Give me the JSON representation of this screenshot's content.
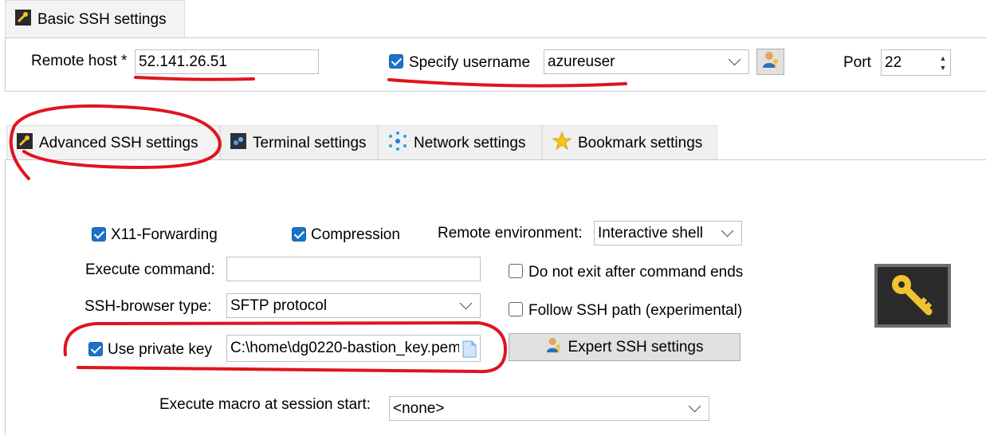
{
  "basic": {
    "tab_label": "Basic SSH settings",
    "remote_host_label": "Remote host *",
    "remote_host_value": "52.141.26.51",
    "specify_username_label": "Specify username",
    "specify_username_checked": true,
    "username_value": "azureuser",
    "port_label": "Port",
    "port_value": "22"
  },
  "tabs": [
    {
      "label": "Advanced SSH settings",
      "icon": "wrench-icon",
      "active": true
    },
    {
      "label": "Terminal settings",
      "icon": "terminal-icon",
      "active": false
    },
    {
      "label": "Network settings",
      "icon": "network-icon",
      "active": false
    },
    {
      "label": "Bookmark settings",
      "icon": "star-icon",
      "active": false
    }
  ],
  "advanced": {
    "x11_label": "X11-Forwarding",
    "x11_checked": true,
    "compression_label": "Compression",
    "compression_checked": true,
    "remote_env_label": "Remote environment:",
    "remote_env_value": "Interactive shell",
    "execute_command_label": "Execute command:",
    "execute_command_value": "",
    "do_not_exit_label": "Do not exit after command ends",
    "do_not_exit_checked": false,
    "ssh_browser_label": "SSH-browser type:",
    "ssh_browser_value": "SFTP protocol",
    "follow_ssh_label": "Follow SSH path (experimental)",
    "follow_ssh_checked": false,
    "use_private_key_label": "Use private key",
    "use_private_key_checked": true,
    "private_key_value": "C:\\home\\dg0220-bastion_key.pem",
    "expert_button_label": "Expert SSH settings",
    "macro_label": "Execute macro at session start:",
    "macro_value": "<none>"
  },
  "colors": {
    "checkbox": "#1a73c9",
    "annotation": "#e0141e",
    "key_tile": "#2b2b2b",
    "key_icon": "#f2c230"
  }
}
